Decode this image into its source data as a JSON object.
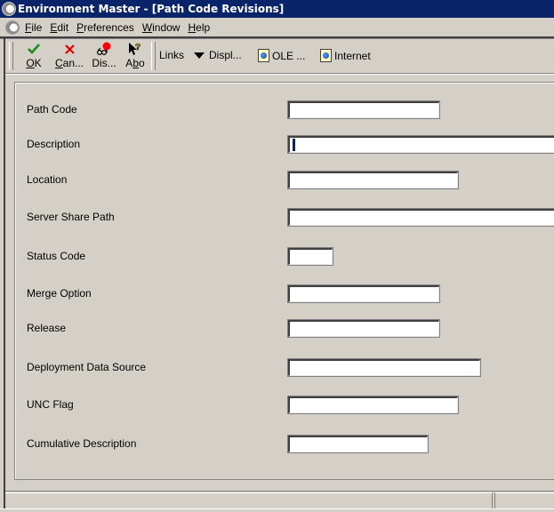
{
  "window": {
    "title": "Environment Master - [Path Code Revisions]"
  },
  "menubar": {
    "items": [
      {
        "label": "File",
        "mnemonic": "F",
        "rest": "ile"
      },
      {
        "label": "Edit",
        "mnemonic": "E",
        "rest": "dit"
      },
      {
        "label": "Preferences",
        "mnemonic": "P",
        "rest": "references"
      },
      {
        "label": "Window",
        "mnemonic": "W",
        "rest": "indow"
      },
      {
        "label": "Help",
        "mnemonic": "H",
        "rest": "elp"
      }
    ]
  },
  "toolbar": {
    "ok": {
      "label": "OK",
      "mnemonic": "O",
      "rest": "K",
      "icon": "checkmark-icon"
    },
    "cancel": {
      "label": "Can...",
      "mnemonic": "C",
      "rest": "an...",
      "icon": "x-icon"
    },
    "display": {
      "label": "Dis...",
      "icon": "glasses-balloon-icon"
    },
    "about": {
      "label": "Abo",
      "pre": "A",
      "mnemonic": "b",
      "rest": "o",
      "icon": "pointer-question-icon"
    },
    "links_label": "Links",
    "display_menu_label": "Displ...",
    "ole_label": "OLE ...",
    "internet_label": "Internet"
  },
  "form": {
    "fields": [
      {
        "label": "Path Code",
        "value": ""
      },
      {
        "label": "Description",
        "value": ""
      },
      {
        "label": "Location",
        "value": ""
      },
      {
        "label": "Server Share Path",
        "value": ""
      },
      {
        "label": "Status Code",
        "value": ""
      },
      {
        "label": "Merge Option",
        "value": ""
      },
      {
        "label": "Release",
        "value": ""
      },
      {
        "label": "Deployment Data Source",
        "value": ""
      },
      {
        "label": "UNC Flag",
        "value": ""
      },
      {
        "label": "Cumulative Description",
        "value": ""
      }
    ]
  },
  "colors": {
    "titlebar": "#0a246a",
    "window_bg": "#d4d0c8",
    "ok_check": "#1a8a1a",
    "cancel_x": "#e00000"
  }
}
